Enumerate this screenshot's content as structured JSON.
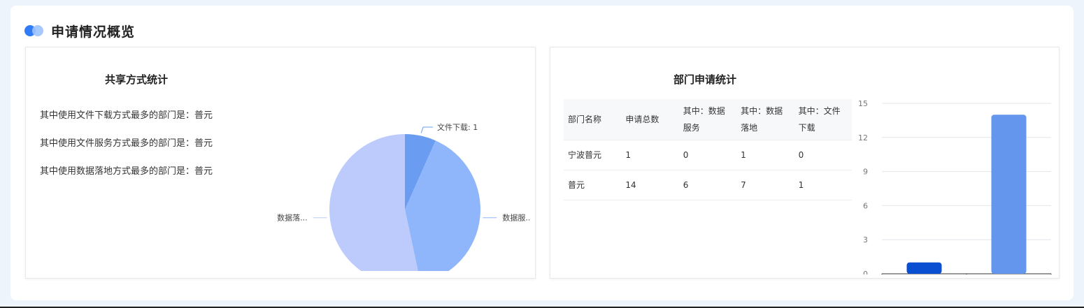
{
  "section": {
    "title": "申请情况概览"
  },
  "share_card": {
    "title": "共享方式统计",
    "stats": [
      {
        "label": "其中使用文件下载方式最多的部门是：",
        "value": "普元"
      },
      {
        "label": "其中使用文件服务方式最多的部门是：",
        "value": "普元"
      },
      {
        "label": "其中使用数据落地方式最多的部门是：",
        "value": "普元"
      }
    ],
    "pie_labels": [
      "文件下载: 1",
      "数据服...",
      "数据落..."
    ]
  },
  "dept_card": {
    "title": "部门申请统计",
    "columns": [
      "部门名称",
      "申请总数",
      "其中：数据服务",
      "其中：数据落地",
      "其中：文件下载"
    ],
    "rows": [
      [
        "宁波普元",
        "1",
        "0",
        "1",
        "0"
      ],
      [
        "普元",
        "14",
        "6",
        "7",
        "1"
      ]
    ]
  },
  "chart_data": [
    {
      "type": "pie",
      "title": "共享方式统计",
      "labels": [
        "文件下载",
        "数据服务",
        "数据落地"
      ],
      "values": [
        1,
        6,
        8
      ],
      "colors": [
        "#6a9cf2",
        "#8fb6fb",
        "#bccbfc"
      ]
    },
    {
      "type": "bar",
      "categories": [
        "宁波普元",
        "普元"
      ],
      "values": [
        1,
        14
      ],
      "colors": [
        "#0a4fd1",
        "#6596ee"
      ],
      "ylim": [
        0,
        15
      ],
      "yticks": [
        0,
        3,
        6,
        9,
        12,
        15
      ]
    }
  ]
}
